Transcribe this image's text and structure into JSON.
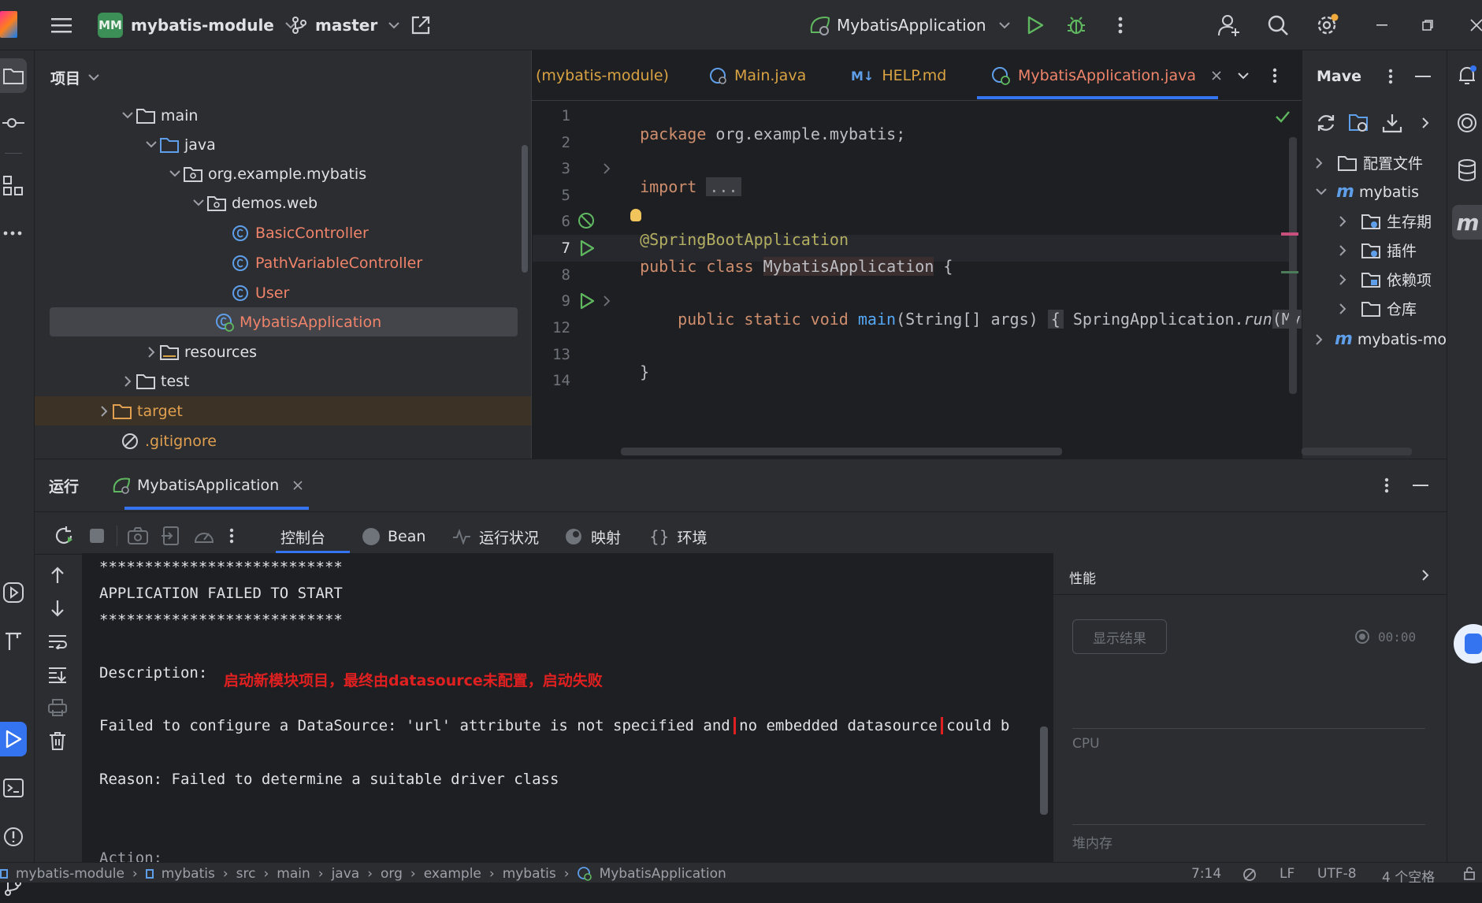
{
  "titlebar": {
    "project_badge": "MM",
    "project_name": "mybatis-module",
    "branch": "master",
    "run_config": "MybatisApplication"
  },
  "project_panel": {
    "title": "项目",
    "items": [
      {
        "label": "main",
        "type": "folder"
      },
      {
        "label": "java",
        "type": "folder-src"
      },
      {
        "label": "org.example.mybatis",
        "type": "package"
      },
      {
        "label": "demos.web",
        "type": "package"
      },
      {
        "label": "BasicController",
        "type": "class"
      },
      {
        "label": "PathVariableController",
        "type": "class"
      },
      {
        "label": "User",
        "type": "class"
      },
      {
        "label": "MybatisApplication",
        "type": "class-app"
      },
      {
        "label": "resources",
        "type": "folder-res"
      },
      {
        "label": "test",
        "type": "folder"
      },
      {
        "label": "target",
        "type": "folder-excluded"
      },
      {
        "label": ".gitignore",
        "type": "ignore"
      }
    ]
  },
  "editor": {
    "tabs": [
      {
        "label": "(mybatis-module)"
      },
      {
        "label": "Main.java"
      },
      {
        "label": "HELP.md",
        "prefix": "M↓"
      },
      {
        "label": "MybatisApplication.java",
        "active": true
      }
    ],
    "line_numbers": [
      "1",
      "2",
      "3",
      "5",
      "6",
      "7",
      "8",
      "9",
      "12",
      "13",
      "14"
    ],
    "code": {
      "l1_kw": "package",
      "l1_rest": " org.example.mybatis;",
      "l3_kw": "import",
      "l3_fold": "...",
      "l6_at": "@",
      "l6_ann": "SpringBootApplication",
      "l7_kw": "public class",
      "l7_cls": "MybatisApplication",
      "l7_rest": " {",
      "l9_kw": "public static void",
      "l9_fn": "main",
      "l9_args": "(String[] args)",
      "l9_brace": "{",
      "l9_body1": " SpringApplication.",
      "l9_run": "run",
      "l9_body2": "(Mybat",
      "l13": "}"
    }
  },
  "maven": {
    "title": "Mave",
    "items": [
      {
        "label": "配置文件"
      },
      {
        "label": "mybatis"
      },
      {
        "label": "生存期"
      },
      {
        "label": "插件"
      },
      {
        "label": "依赖项"
      },
      {
        "label": "仓库"
      },
      {
        "label": "mybatis-mo"
      }
    ]
  },
  "run_panel": {
    "title": "运行",
    "tab": "MybatisApplication",
    "subtabs": [
      {
        "label": "控制台",
        "active": true
      },
      {
        "label": "Bean"
      },
      {
        "label": "运行状况"
      },
      {
        "label": "映射"
      },
      {
        "label": "环境"
      }
    ],
    "console": [
      "***************************",
      "APPLICATION FAILED TO START",
      "***************************",
      "Description:",
      "Failed to configure a DataSource: 'url' attribute is not specified and ",
      "no embedded datasource",
      " could b",
      "Reason: Failed to determine a suitable driver class",
      "Action:"
    ],
    "annotation": "启动新模块项目，最终由datasource未配置，启动失败",
    "annotation_color": "#e02020"
  },
  "perf_panel": {
    "title": "性能",
    "show_results": "显示结果",
    "timer": "00:00",
    "cpu": "CPU",
    "heap": "堆内存"
  },
  "statusbar": {
    "breadcrumbs": [
      "mybatis-module",
      "mybatis",
      "src",
      "main",
      "java",
      "org",
      "example",
      "mybatis",
      "MybatisApplication"
    ],
    "position": "7:14",
    "line_sep": "LF",
    "encoding": "UTF-8",
    "indent": "4 个空格"
  }
}
